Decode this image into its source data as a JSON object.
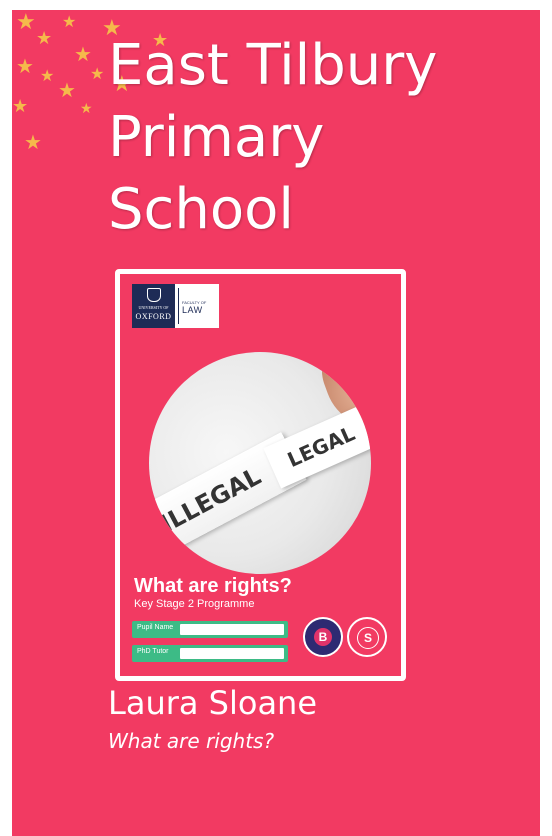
{
  "colors": {
    "background": "#f23a62",
    "text": "#ffffff",
    "star": "#f6c04a",
    "oxford_navy": "#1e2b56",
    "field_green": "#3dbb86",
    "badge_purple": "#2e2a72"
  },
  "header": {
    "title_lines": [
      "East Tilbury",
      "Primary",
      "School"
    ]
  },
  "cover": {
    "logo": {
      "university_small": "UNIVERSITY OF",
      "university_name": "OXFORD",
      "faculty_small": "FACULTY OF",
      "faculty_name": "LAW"
    },
    "photo_labels": {
      "illegal": "ILLEGAL",
      "legal": "LEGAL"
    },
    "heading": "What are rights?",
    "programme": "Key Stage 2 Programme",
    "fields": [
      {
        "label": "Pupil Name",
        "value": ""
      },
      {
        "label": "PhD Tutor",
        "value": ""
      }
    ],
    "badges": [
      {
        "letter": "B",
        "icon": "b-award-badge-icon"
      },
      {
        "letter": "S",
        "icon": "s-award-badge-icon"
      }
    ]
  },
  "footer": {
    "author": "Laura Sloane",
    "book_title": "What are rights?"
  },
  "decor": {
    "icon": "star-icon",
    "glyph": "★"
  }
}
